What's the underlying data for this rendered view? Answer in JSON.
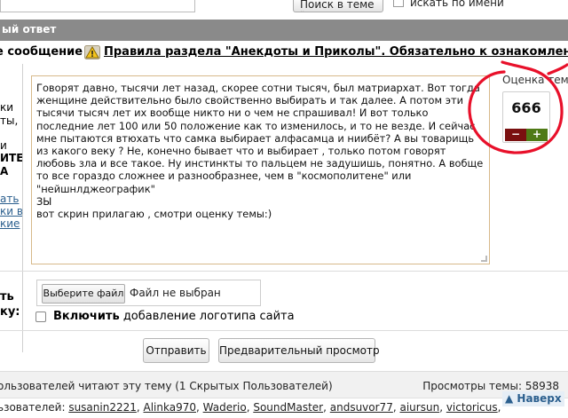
{
  "top": {
    "search_button_label": "Поиск в теме »",
    "name_search_label": "искать по имени"
  },
  "quick_reply": {
    "title": "ый ответ"
  },
  "rules": {
    "prefix": "е сообщение",
    "link_text": "Правила раздела \"Анекдоты и Приколы\". Обязательно к ознакомлению"
  },
  "left_column": {
    "fragments": [
      "ки",
      "ты,",
      "",
      "и",
      "ИТЕ",
      "А",
      "",
      "ать",
      "ки в",
      "кие"
    ]
  },
  "message": {
    "text": "Говорят давно, тысячи лет назад, скорее сотни тысяч, был матриархат. Вот тогда женщине действительно было свойственно выбирать и так далее. А потом эти тысячи тысяч лет их вообще никто ни о чем не спрашивал! И вот только последние лет 100 или 50 положение как то изменилось, и то не везде. И сейчас мне пытаются втюхать что самка выбирает алфасамца и ниибёт? А вы товарищь из какого веку ? Не, конечно бывает что и выбирает , только потом говорят любовь зла и все такое. Ну инстинкты то пальцем не задушишь, понятно. А вобще то все гораздо сложнее и разнообразнее, чем в \"космополитене\" или \"нейшнлджеографик\"",
    "ps": "ЗЫ",
    "last_line": "вот скрин прилагаю , смотри оценку темы:)"
  },
  "rating": {
    "label": "Оценка темы",
    "value": "666",
    "minus": "−",
    "plus": "+",
    "colors": {
      "minus": "#7a1010",
      "plus": "#4f7a16",
      "highlight": "#e8102a"
    }
  },
  "attach": {
    "label_line1": "ть",
    "label_line2": "ку:",
    "file_button": "Выберите файл",
    "file_status": "Файл не выбран",
    "logo_bold": "Включить",
    "logo_rest": " добавление логотипа сайта"
  },
  "buttons": {
    "send": "Отправить",
    "preview": "Предварительный просмотр"
  },
  "footer": {
    "reading": "ользователей читают эту тему (1 Скрытых Пользователей)",
    "views": "Просмотры темы: 58938",
    "users_prefix": "ьзователей: ",
    "users": [
      "susanin2221",
      "Alinka970",
      "Waderio",
      "SoundMaster",
      "andsuvor77",
      "aiursun",
      "victoricus"
    ],
    "up_link": "▲ Наверх"
  }
}
